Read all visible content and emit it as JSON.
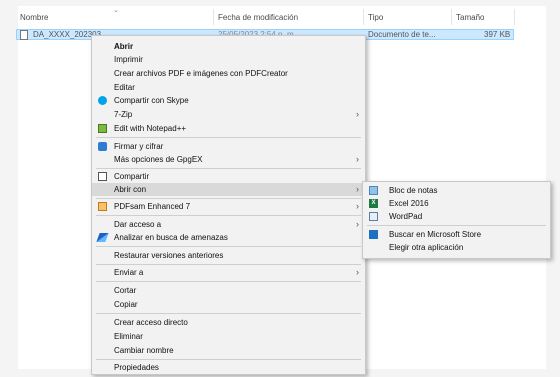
{
  "explorer": {
    "columns": {
      "name": "Nombre",
      "modified": "Fecha de modificación",
      "type": "Tipo",
      "size": "Tamaño"
    },
    "file": {
      "name": "DA_XXXX_202303",
      "modified": "25/05/2023 2:54 p. m.",
      "type": "Documento de te...",
      "size": "397 KB"
    }
  },
  "context_menu": {
    "items": {
      "abrir": "Abrir",
      "imprimir": "Imprimir",
      "pdfcreator": "Crear archivos PDF e imágenes con PDFCreator",
      "editar": "Editar",
      "skype": "Compartir con Skype",
      "sevenzip": "7-Zip",
      "notepadpp": "Edit with Notepad++",
      "firmar": "Firmar y cifrar",
      "gpgex": "Más opciones de GpgEX",
      "compartir": "Compartir",
      "abrir_con": "Abrir con",
      "pdfsam": "PDFsam Enhanced 7",
      "dar_acceso": "Dar acceso a",
      "analizar": "Analizar en busca de amenazas",
      "restaurar": "Restaurar versiones anteriores",
      "enviar": "Enviar a",
      "cortar": "Cortar",
      "copiar": "Copiar",
      "acceso_directo": "Crear acceso directo",
      "eliminar": "Eliminar",
      "cambiar_nombre": "Cambiar nombre",
      "propiedades": "Propiedades"
    },
    "submenu_glyph": "›"
  },
  "open_with_menu": {
    "bloc": "Bloc de notas",
    "excel": "Excel 2016",
    "wordpad": "WordPad",
    "store": "Buscar en Microsoft Store",
    "otra": "Elegir otra aplicación"
  },
  "icons": {
    "skype": "skype-icon",
    "notepadpp": "notepad-plus-plus-icon",
    "lock": "lock-icon",
    "share": "share-icon",
    "pdfsam": "pdfsam-icon",
    "defender": "defender-icon",
    "notepad": "notepad-icon",
    "excel": "excel-icon",
    "wordpad": "wordpad-icon",
    "store": "store-icon"
  },
  "colors": {
    "selection": "#cce8ff",
    "menu_bg": "#f2f2f2",
    "highlight": "#d9d9d9",
    "excel": "#1d7a45",
    "skype": "#00a3e8"
  }
}
